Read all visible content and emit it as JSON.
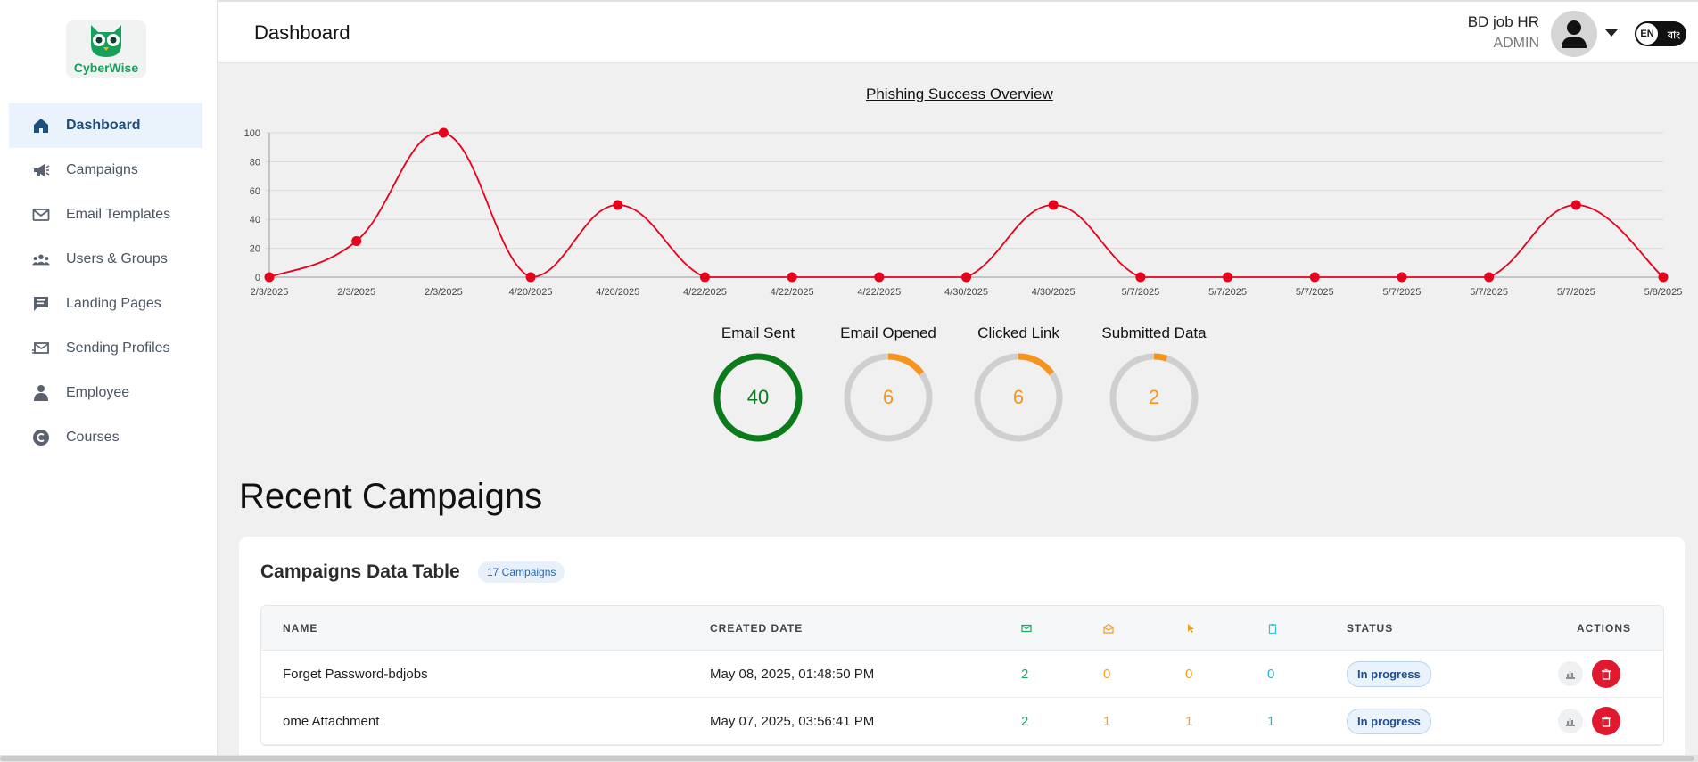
{
  "brand": {
    "name": "CyberWise",
    "accent": "#17a05b"
  },
  "sidebar": {
    "items": [
      {
        "label": "Dashboard",
        "icon": "home-icon",
        "active": true
      },
      {
        "label": "Campaigns",
        "icon": "megaphone-icon"
      },
      {
        "label": "Email Templates",
        "icon": "mail-icon"
      },
      {
        "label": "Users & Groups",
        "icon": "users-icon"
      },
      {
        "label": "Landing Pages",
        "icon": "message-icon"
      },
      {
        "label": "Sending Profiles",
        "icon": "mail-send-icon"
      },
      {
        "label": "Employee",
        "icon": "person-icon"
      },
      {
        "label": "Courses",
        "icon": "copyright-icon"
      }
    ]
  },
  "header": {
    "title": "Dashboard",
    "user_name": "BD job HR",
    "user_role": "ADMIN",
    "lang_active": "EN",
    "lang_other": "বাং"
  },
  "chart_data": {
    "type": "line",
    "title": "Phishing Success Overview",
    "x": [
      "2/3/2025",
      "2/3/2025",
      "2/3/2025",
      "4/20/2025",
      "4/20/2025",
      "4/22/2025",
      "4/22/2025",
      "4/22/2025",
      "4/30/2025",
      "4/30/2025",
      "5/7/2025",
      "5/7/2025",
      "5/7/2025",
      "5/7/2025",
      "5/7/2025",
      "5/7/2025",
      "5/8/2025"
    ],
    "series": [
      {
        "values": [
          0,
          25,
          100,
          0,
          50,
          0,
          0,
          0,
          0,
          50,
          0,
          0,
          0,
          0,
          0,
          50,
          0
        ],
        "color": "#e8001c"
      }
    ],
    "y_ticks": [
      0,
      20,
      40,
      60,
      80,
      100
    ],
    "ylim": [
      0,
      100
    ],
    "grid": true,
    "curve": "smooth"
  },
  "stats": [
    {
      "label": "Email Sent",
      "value": "40",
      "fraction": 1.0,
      "color": "#0a7a1a"
    },
    {
      "label": "Email Opened",
      "value": "6",
      "fraction": 0.15,
      "color": "#f7941d"
    },
    {
      "label": "Clicked Link",
      "value": "6",
      "fraction": 0.15,
      "color": "#f7941d"
    },
    {
      "label": "Submitted Data",
      "value": "2",
      "fraction": 0.05,
      "color": "#f7941d"
    }
  ],
  "recent": {
    "title": "Recent Campaigns",
    "table_title": "Campaigns Data Table",
    "count_badge": "17 Campaigns",
    "columns": {
      "name": "NAME",
      "created": "CREATED DATE",
      "sent_icon": "mail-icon",
      "opened_icon": "mail-open-icon",
      "clicked_icon": "cursor-icon",
      "submitted_icon": "clipboard-icon",
      "status": "STATUS",
      "actions": "ACTIONS"
    },
    "rows": [
      {
        "name": "Forget Password-bdjobs",
        "created": "May 08, 2025, 01:48:50 PM",
        "sent": "2",
        "opened": "0",
        "clicked": "0",
        "submitted": "0",
        "status": "In progress"
      },
      {
        "name": "ome Attachment",
        "created": "May 07, 2025, 03:56:41 PM",
        "sent": "2",
        "opened": "1",
        "clicked": "1",
        "submitted": "1",
        "status": "In progress"
      }
    ]
  }
}
